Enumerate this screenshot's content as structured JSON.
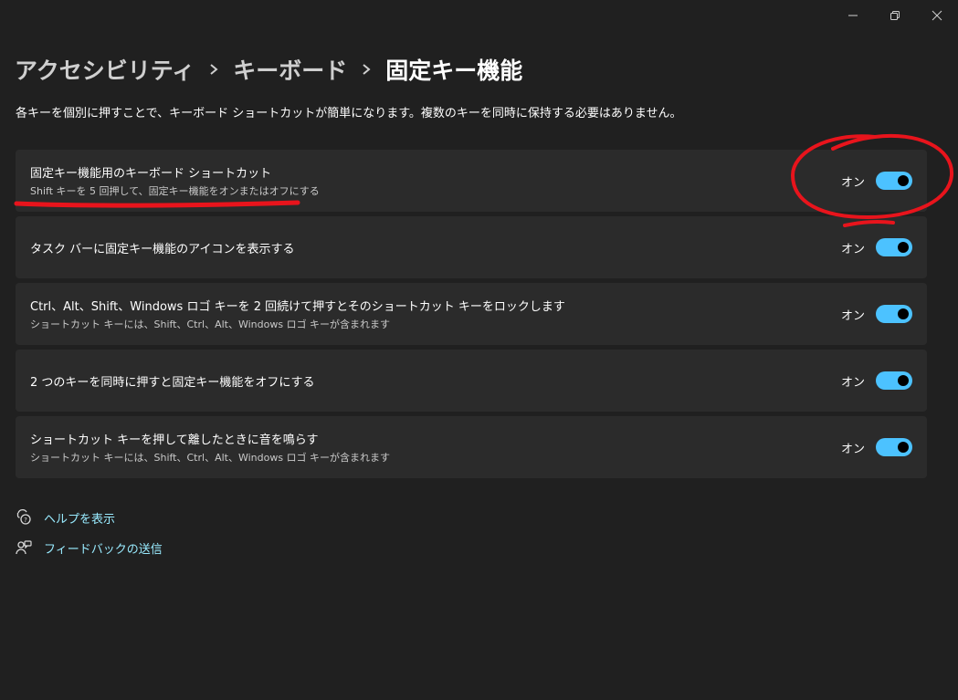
{
  "window": {
    "controls": {
      "minimize": "minimize-icon",
      "restore": "restore-icon",
      "close": "close-icon"
    }
  },
  "breadcrumb": {
    "items": [
      "アクセシビリティ",
      "キーボード",
      "固定キー機能"
    ],
    "separator_icon": "chevron-right-icon"
  },
  "description": "各キーを個別に押すことで、キーボード ショートカットが簡単になります。複数のキーを同時に保持する必要はありません。",
  "settings": [
    {
      "title": "固定キー機能用のキーボード ショートカット",
      "subtitle": "Shift キーを 5 回押して、固定キー機能をオンまたはオフにする",
      "state_label": "オン",
      "on": true
    },
    {
      "title": "タスク バーに固定キー機能のアイコンを表示する",
      "subtitle": "",
      "state_label": "オン",
      "on": true
    },
    {
      "title": "Ctrl、Alt、Shift、Windows ロゴ キーを 2 回続けて押すとそのショートカット キーをロックします",
      "subtitle": "ショートカット キーには、Shift、Ctrl、Alt、Windows ロゴ キーが含まれます",
      "state_label": "オン",
      "on": true
    },
    {
      "title": "2 つのキーを同時に押すと固定キー機能をオフにする",
      "subtitle": "",
      "state_label": "オン",
      "on": true
    },
    {
      "title": "ショートカット キーを押して離したときに音を鳴らす",
      "subtitle": "ショートカット キーには、Shift、Ctrl、Alt、Windows ロゴ キーが含まれます",
      "state_label": "オン",
      "on": true
    }
  ],
  "links": {
    "help": {
      "label": "ヘルプを表示",
      "icon": "help-chat-icon"
    },
    "feedback": {
      "label": "フィードバックの送信",
      "icon": "feedback-icon"
    }
  },
  "colors": {
    "background": "#202020",
    "card": "#2b2b2b",
    "accent": "#4cc2ff",
    "link": "#99ebff",
    "annotation": "#e8141c"
  }
}
